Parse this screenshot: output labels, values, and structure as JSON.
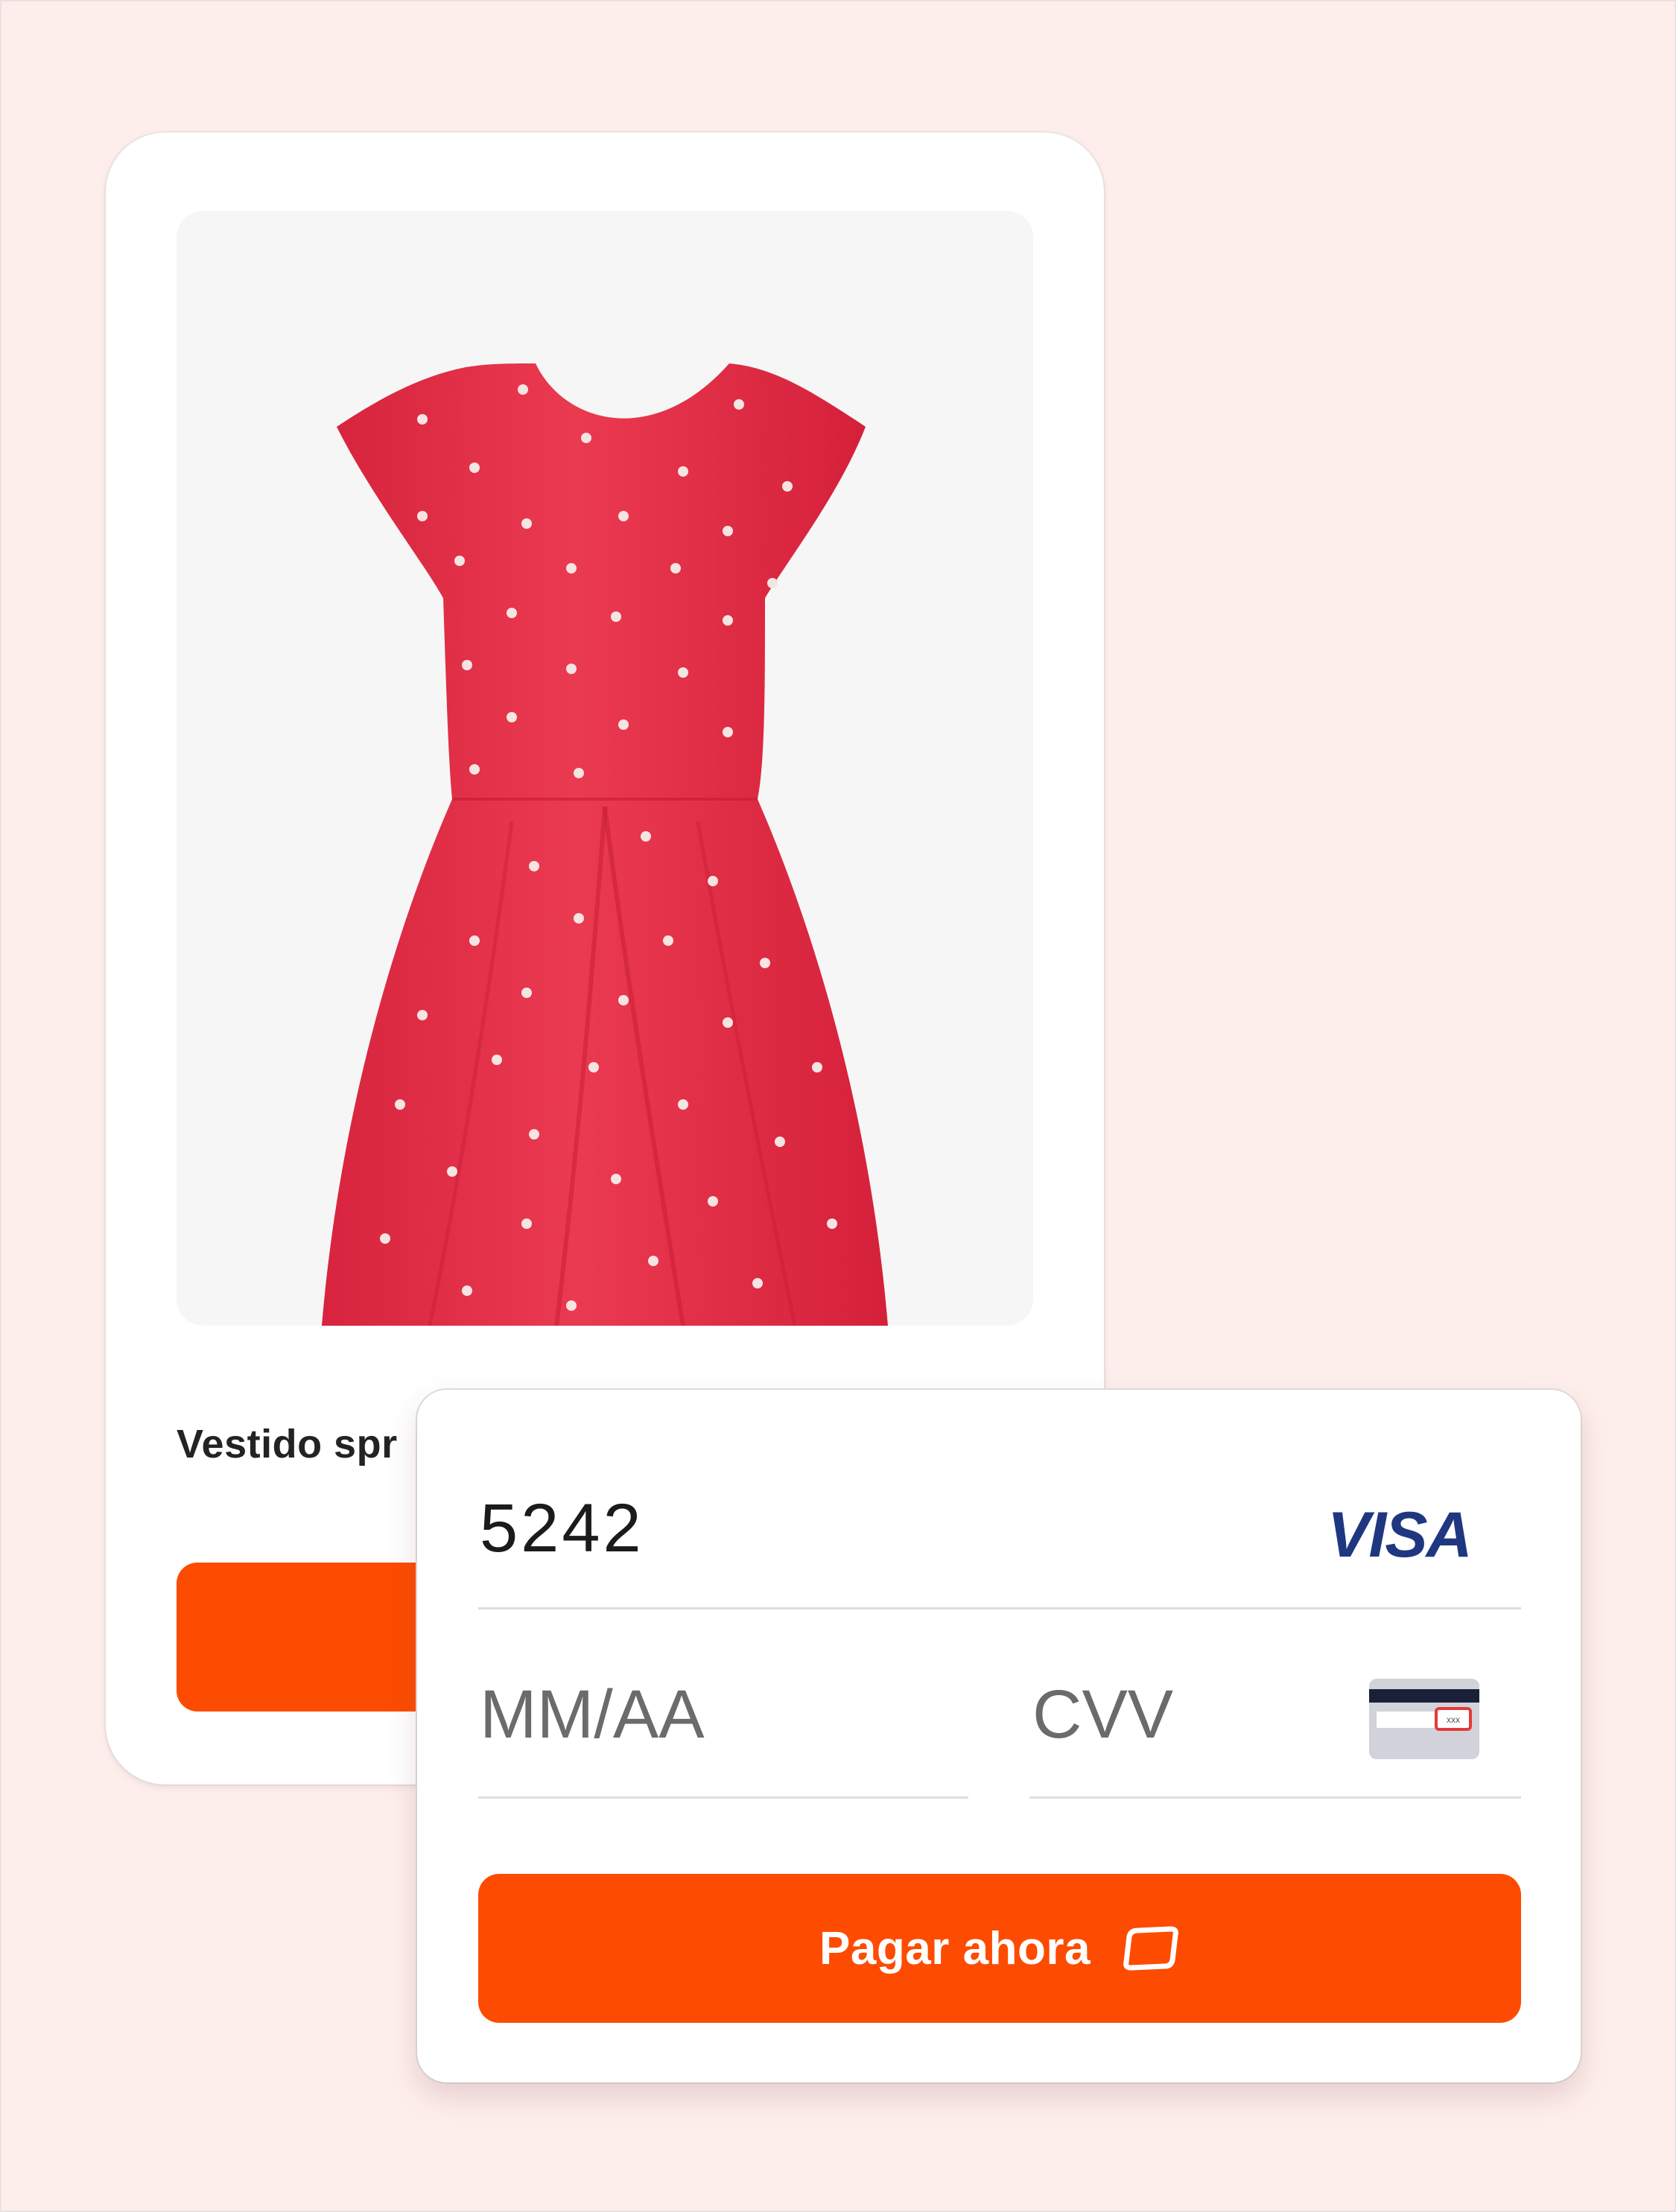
{
  "product": {
    "title": "Vestido spr",
    "image_icon": "red-polka-dot-dress",
    "button_color": "#fd4c02"
  },
  "payment": {
    "card_number": "5242",
    "card_brand": "VISA",
    "expiry_placeholder": "MM/AA",
    "cvv_placeholder": "CVV",
    "cvv_icon": "card-cvv-icon",
    "cvv_icon_text": "xxx",
    "pay_button_label": "Pagar ahora",
    "pay_button_icon": "card-icon",
    "accent_color": "#fd4c02",
    "brand_color": "#1e3780"
  }
}
